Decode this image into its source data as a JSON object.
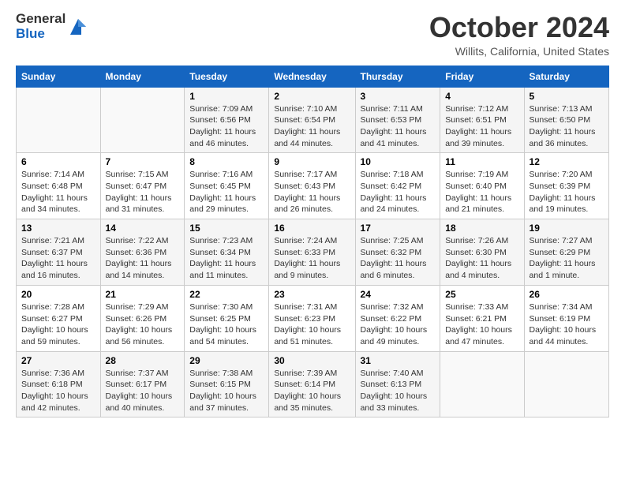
{
  "header": {
    "logo_general": "General",
    "logo_blue": "Blue",
    "title": "October 2024",
    "location": "Willits, California, United States"
  },
  "days_of_week": [
    "Sunday",
    "Monday",
    "Tuesday",
    "Wednesday",
    "Thursday",
    "Friday",
    "Saturday"
  ],
  "weeks": [
    [
      {
        "day": "",
        "info": ""
      },
      {
        "day": "",
        "info": ""
      },
      {
        "day": "1",
        "info": "Sunrise: 7:09 AM\nSunset: 6:56 PM\nDaylight: 11 hours and 46 minutes."
      },
      {
        "day": "2",
        "info": "Sunrise: 7:10 AM\nSunset: 6:54 PM\nDaylight: 11 hours and 44 minutes."
      },
      {
        "day": "3",
        "info": "Sunrise: 7:11 AM\nSunset: 6:53 PM\nDaylight: 11 hours and 41 minutes."
      },
      {
        "day": "4",
        "info": "Sunrise: 7:12 AM\nSunset: 6:51 PM\nDaylight: 11 hours and 39 minutes."
      },
      {
        "day": "5",
        "info": "Sunrise: 7:13 AM\nSunset: 6:50 PM\nDaylight: 11 hours and 36 minutes."
      }
    ],
    [
      {
        "day": "6",
        "info": "Sunrise: 7:14 AM\nSunset: 6:48 PM\nDaylight: 11 hours and 34 minutes."
      },
      {
        "day": "7",
        "info": "Sunrise: 7:15 AM\nSunset: 6:47 PM\nDaylight: 11 hours and 31 minutes."
      },
      {
        "day": "8",
        "info": "Sunrise: 7:16 AM\nSunset: 6:45 PM\nDaylight: 11 hours and 29 minutes."
      },
      {
        "day": "9",
        "info": "Sunrise: 7:17 AM\nSunset: 6:43 PM\nDaylight: 11 hours and 26 minutes."
      },
      {
        "day": "10",
        "info": "Sunrise: 7:18 AM\nSunset: 6:42 PM\nDaylight: 11 hours and 24 minutes."
      },
      {
        "day": "11",
        "info": "Sunrise: 7:19 AM\nSunset: 6:40 PM\nDaylight: 11 hours and 21 minutes."
      },
      {
        "day": "12",
        "info": "Sunrise: 7:20 AM\nSunset: 6:39 PM\nDaylight: 11 hours and 19 minutes."
      }
    ],
    [
      {
        "day": "13",
        "info": "Sunrise: 7:21 AM\nSunset: 6:37 PM\nDaylight: 11 hours and 16 minutes."
      },
      {
        "day": "14",
        "info": "Sunrise: 7:22 AM\nSunset: 6:36 PM\nDaylight: 11 hours and 14 minutes."
      },
      {
        "day": "15",
        "info": "Sunrise: 7:23 AM\nSunset: 6:34 PM\nDaylight: 11 hours and 11 minutes."
      },
      {
        "day": "16",
        "info": "Sunrise: 7:24 AM\nSunset: 6:33 PM\nDaylight: 11 hours and 9 minutes."
      },
      {
        "day": "17",
        "info": "Sunrise: 7:25 AM\nSunset: 6:32 PM\nDaylight: 11 hours and 6 minutes."
      },
      {
        "day": "18",
        "info": "Sunrise: 7:26 AM\nSunset: 6:30 PM\nDaylight: 11 hours and 4 minutes."
      },
      {
        "day": "19",
        "info": "Sunrise: 7:27 AM\nSunset: 6:29 PM\nDaylight: 11 hours and 1 minute."
      }
    ],
    [
      {
        "day": "20",
        "info": "Sunrise: 7:28 AM\nSunset: 6:27 PM\nDaylight: 10 hours and 59 minutes."
      },
      {
        "day": "21",
        "info": "Sunrise: 7:29 AM\nSunset: 6:26 PM\nDaylight: 10 hours and 56 minutes."
      },
      {
        "day": "22",
        "info": "Sunrise: 7:30 AM\nSunset: 6:25 PM\nDaylight: 10 hours and 54 minutes."
      },
      {
        "day": "23",
        "info": "Sunrise: 7:31 AM\nSunset: 6:23 PM\nDaylight: 10 hours and 51 minutes."
      },
      {
        "day": "24",
        "info": "Sunrise: 7:32 AM\nSunset: 6:22 PM\nDaylight: 10 hours and 49 minutes."
      },
      {
        "day": "25",
        "info": "Sunrise: 7:33 AM\nSunset: 6:21 PM\nDaylight: 10 hours and 47 minutes."
      },
      {
        "day": "26",
        "info": "Sunrise: 7:34 AM\nSunset: 6:19 PM\nDaylight: 10 hours and 44 minutes."
      }
    ],
    [
      {
        "day": "27",
        "info": "Sunrise: 7:36 AM\nSunset: 6:18 PM\nDaylight: 10 hours and 42 minutes."
      },
      {
        "day": "28",
        "info": "Sunrise: 7:37 AM\nSunset: 6:17 PM\nDaylight: 10 hours and 40 minutes."
      },
      {
        "day": "29",
        "info": "Sunrise: 7:38 AM\nSunset: 6:15 PM\nDaylight: 10 hours and 37 minutes."
      },
      {
        "day": "30",
        "info": "Sunrise: 7:39 AM\nSunset: 6:14 PM\nDaylight: 10 hours and 35 minutes."
      },
      {
        "day": "31",
        "info": "Sunrise: 7:40 AM\nSunset: 6:13 PM\nDaylight: 10 hours and 33 minutes."
      },
      {
        "day": "",
        "info": ""
      },
      {
        "day": "",
        "info": ""
      }
    ]
  ]
}
